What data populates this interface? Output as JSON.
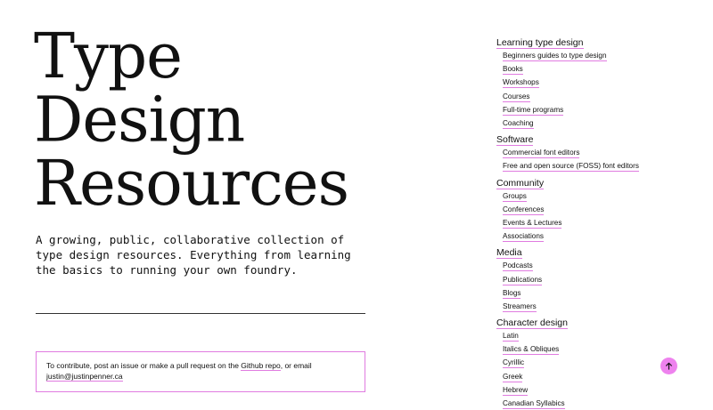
{
  "hero": {
    "title_lines": [
      "Type",
      "Design",
      "Resources"
    ],
    "intro": "A growing, public, collaborative collection of type design resources. Everything from learning the basics to running your own foundry."
  },
  "contribute": {
    "text_before": "To contribute, post an issue or make a pull request on the ",
    "repo_link": "Github repo",
    "text_middle": ", or email ",
    "email": "justin@justinpenner.ca"
  },
  "toc": {
    "sections": [
      {
        "heading": "Learning type design",
        "items": [
          "Beginners guides to type design",
          "Books",
          "Workshops",
          "Courses",
          "Full-time programs",
          "Coaching"
        ]
      },
      {
        "heading": "Software",
        "items": [
          "Commercial font editors",
          "Free and open source (FOSS) font editors"
        ]
      },
      {
        "heading": "Community",
        "items": [
          "Groups",
          "Conferences",
          "Events & Lectures",
          "Associations"
        ]
      },
      {
        "heading": "Media",
        "items": [
          "Podcasts",
          "Publications",
          "Blogs",
          "Streamers"
        ]
      },
      {
        "heading": "Character design",
        "items": [
          "Latin",
          "Italics & Obliques",
          "Cyrillic",
          "Greek",
          "Hebrew",
          "Canadian Syllabics"
        ]
      }
    ]
  },
  "colors": {
    "accent": "#ee82ee",
    "underline": "#e07be0",
    "text": "#111111",
    "background": "#ffffff"
  },
  "icons": {
    "scroll_top": "arrow-up-icon"
  }
}
